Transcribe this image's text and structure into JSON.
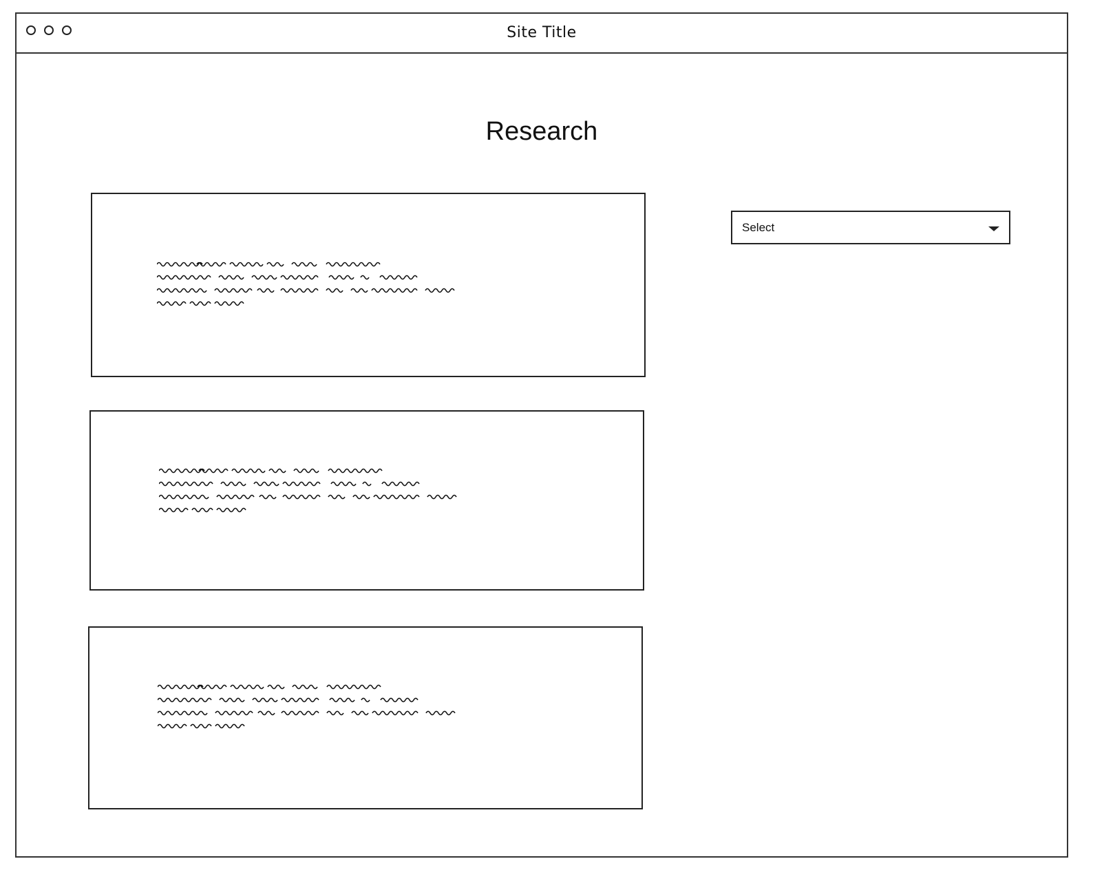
{
  "window": {
    "title": "Site Title"
  },
  "page": {
    "heading": "Research"
  },
  "cards": [
    {
      "content": "placeholder-scribble-text"
    },
    {
      "content": "placeholder-scribble-text"
    },
    {
      "content": "placeholder-scribble-text"
    }
  ],
  "filter": {
    "selected": "Select",
    "icon": "chevron-down-icon"
  }
}
